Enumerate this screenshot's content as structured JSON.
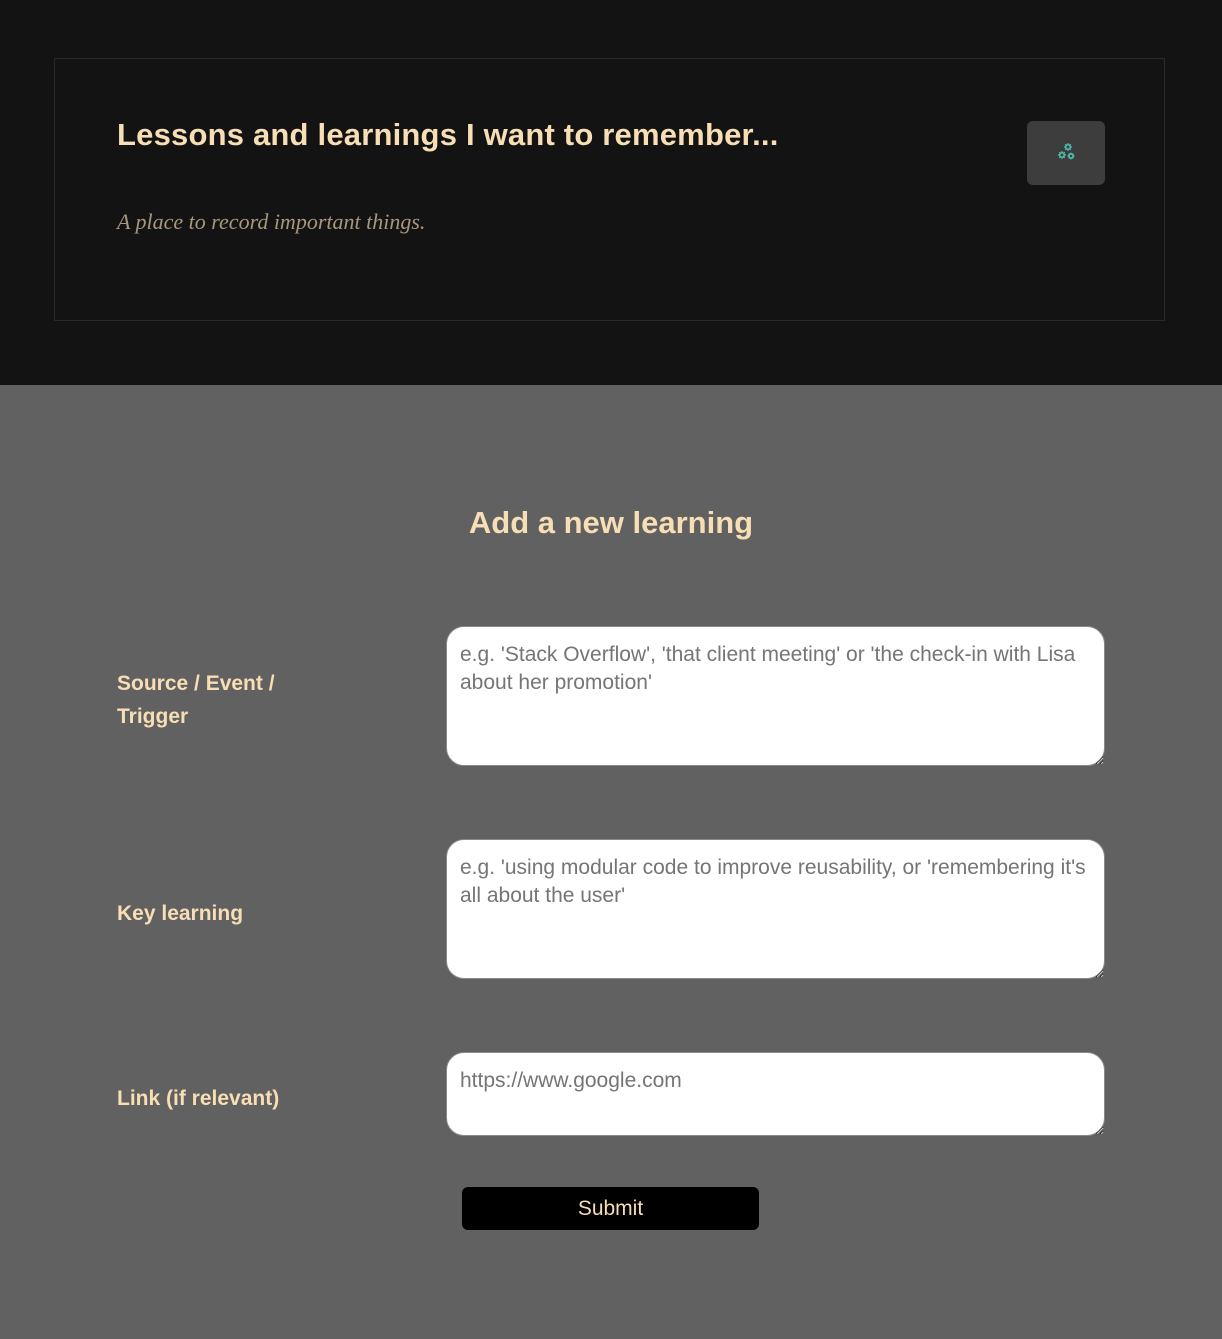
{
  "header": {
    "title": "Lessons and learnings I want to remember...",
    "subtitle": "A place to record important things.",
    "settings_button_icon": "gears-icon"
  },
  "form": {
    "title": "Add a new learning",
    "fields": [
      {
        "label": "Source / Event / Trigger",
        "placeholder": "e.g. 'Stack Overflow', 'that client meeting' or 'the check-in with Lisa about her promotion'",
        "value": ""
      },
      {
        "label": "Key learning",
        "placeholder": "e.g. 'using modular code to improve reusability, or 'remembering it's all about the user'",
        "value": ""
      },
      {
        "label": "Link (if relevant)",
        "placeholder": "https://www.google.com",
        "value": ""
      }
    ],
    "submit_label": "Submit"
  },
  "colors": {
    "header_background": "#131313",
    "form_background": "#616161",
    "accent_text": "#f7deb5",
    "subtitle_text": "#a8977d",
    "icon_color": "#4fc3b5"
  }
}
